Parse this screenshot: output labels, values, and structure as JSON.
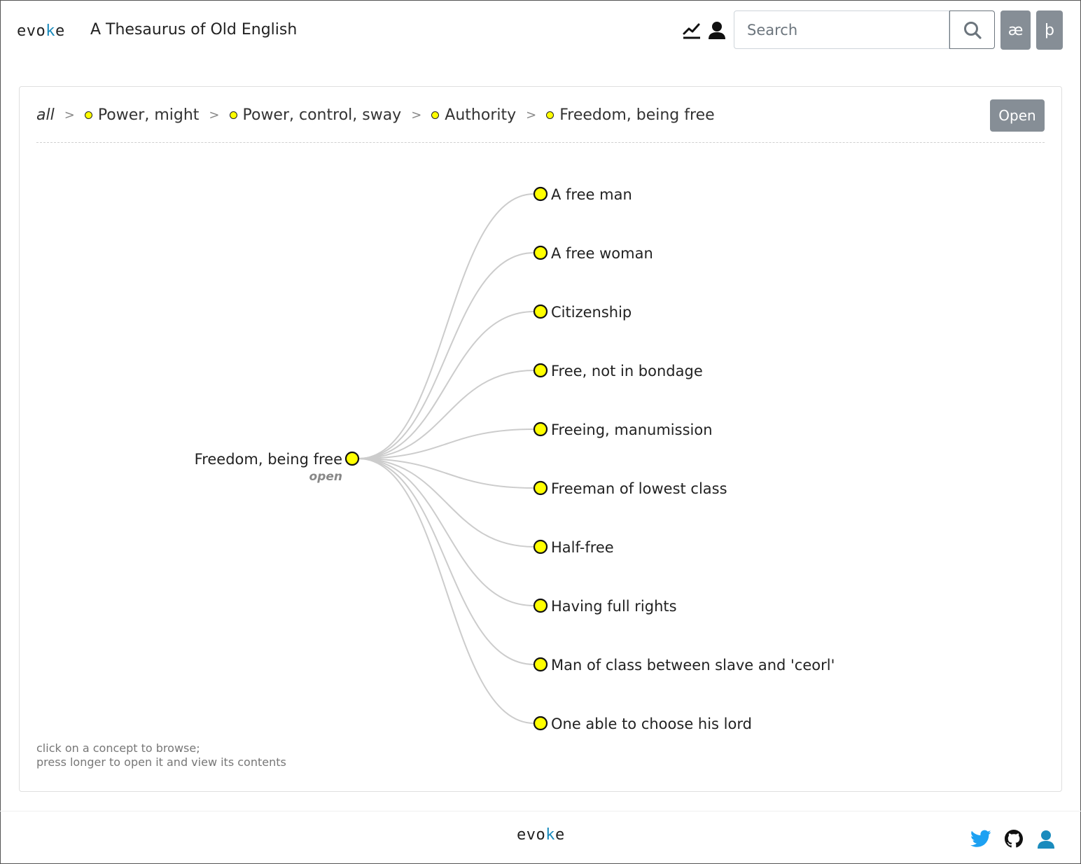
{
  "header": {
    "logo": {
      "prefix": "evo",
      "accent": "k",
      "suffix": "e"
    },
    "title": "A Thesaurus of Old English",
    "search": {
      "placeholder": "Search",
      "value": ""
    },
    "char_buttons": [
      "æ",
      "þ"
    ],
    "icons": [
      "stats-icon",
      "user-icon",
      "search-icon"
    ]
  },
  "breadcrumb": {
    "root": "all",
    "separator": ">",
    "items": [
      "Power, might",
      "Power, control, sway",
      "Authority",
      "Freedom, being free"
    ]
  },
  "open_button": "Open",
  "tree": {
    "root": {
      "label": "Freedom, being free",
      "sublabel": "open"
    },
    "children": [
      "A free man",
      "A free woman",
      "Citizenship",
      "Free, not in bondage",
      "Freeing, manumission",
      "Freeman of lowest class",
      "Half-free",
      "Having full rights",
      "Man of class between slave and 'ceorl'",
      "One able to choose his lord"
    ],
    "node_color": "#ffff00",
    "link_color": "#cccccc"
  },
  "hint": {
    "line1": "click on a concept to browse;",
    "line2": "press longer to open it and view its contents"
  },
  "footer": {
    "logo": {
      "prefix": "evo",
      "accent": "k",
      "suffix": "e"
    },
    "icons": [
      "twitter-icon",
      "github-icon",
      "account-icon"
    ],
    "twitter_color": "#1da1f2",
    "account_color": "#1a8bbd"
  }
}
